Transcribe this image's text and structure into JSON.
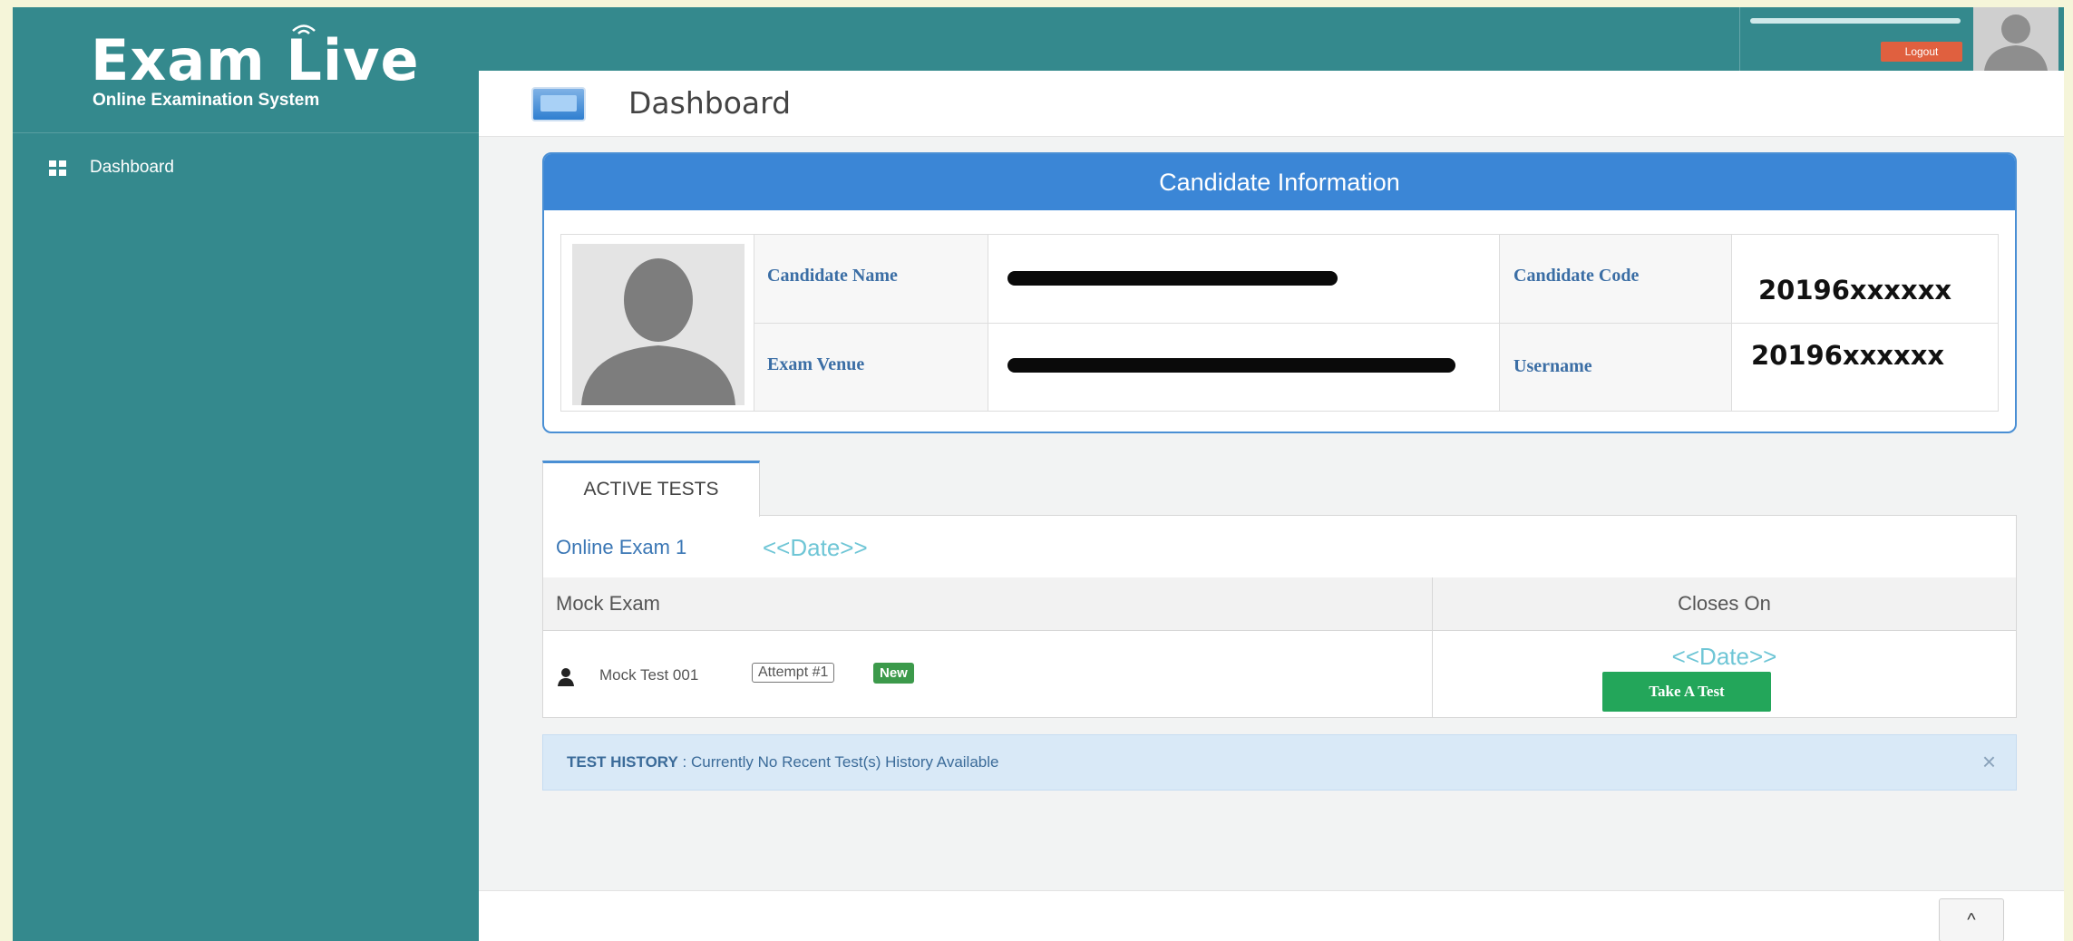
{
  "brand": {
    "title": "Exam Live",
    "subtitle": "Online Examination System"
  },
  "sidebar": {
    "items": [
      {
        "label": "Dashboard",
        "icon": "grid-icon"
      }
    ]
  },
  "topbar": {
    "logout_label": "Logout"
  },
  "page": {
    "title": "Dashboard"
  },
  "candidate": {
    "heading": "Candidate Information",
    "name_label": "Candidate Name",
    "venue_label": "Exam Venue",
    "code_label": "Candidate Code",
    "code_value": "20196xxxxxx",
    "username_label": "Username",
    "username_value": "20196xxxxxx"
  },
  "tests": {
    "tab_label": "ACTIVE TESTS",
    "exam_name": "Online Exam 1",
    "exam_date": "<<Date>>",
    "col_mock": "Mock Exam",
    "col_closes": "Closes On",
    "rows": [
      {
        "name": "Mock Test 001",
        "attempt": "Attempt #1",
        "badge": "New",
        "closes": "<<Date>>",
        "action": "Take A Test"
      }
    ]
  },
  "history": {
    "label": "TEST HISTORY",
    "message": " : Currently No Recent Test(s) History Available",
    "close": "×"
  },
  "footer": {
    "scroll_top": "^"
  },
  "colors": {
    "sidebar": "#34898d",
    "panel_header": "#3b86d6",
    "button_green": "#23a65a",
    "logout": "#e0603f"
  }
}
